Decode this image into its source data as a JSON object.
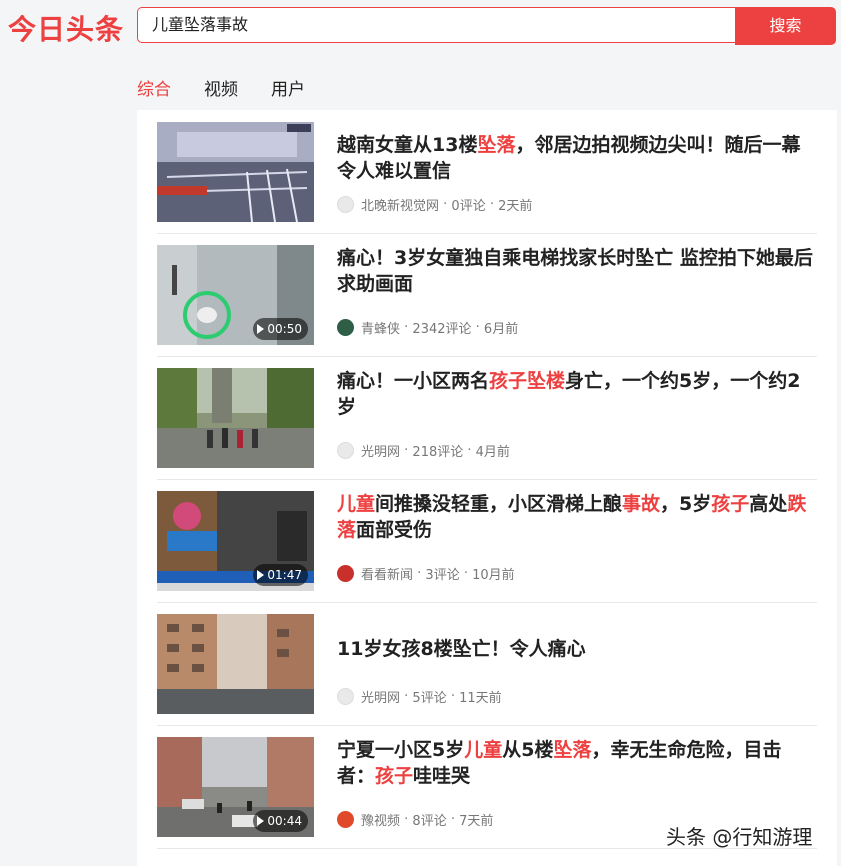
{
  "header": {
    "logo_text": "今日头条",
    "search_value": "儿童坠落事故",
    "search_button": "搜索"
  },
  "tabs": [
    {
      "label": "综合",
      "active": true
    },
    {
      "label": "视频",
      "active": false
    },
    {
      "label": "用户",
      "active": false
    }
  ],
  "results": [
    {
      "title": [
        {
          "t": "越南女童从13楼"
        },
        {
          "t": "坠落",
          "hl": true
        },
        {
          "t": "，邻居边拍视频边尖叫！随后一幕令人难以置信"
        }
      ],
      "source": "北晚新视觉网",
      "comments": "0评论",
      "time": "2天前",
      "source_icon": "newspaper-icon",
      "duration": null
    },
    {
      "title": [
        {
          "t": "痛心！3岁女童独自乘电梯找家长时坠亡 监控拍下她最后求助画面"
        }
      ],
      "source": "青蜂侠",
      "comments": "2342评论",
      "time": "6月前",
      "source_icon": "shield-icon",
      "duration": "00:50"
    },
    {
      "title": [
        {
          "t": "痛心！一小区两名"
        },
        {
          "t": "孩子坠楼",
          "hl": true
        },
        {
          "t": "身亡，一个约5岁，一个约2岁"
        }
      ],
      "source": "光明网",
      "comments": "218评论",
      "time": "4月前",
      "source_icon": "newspaper-icon",
      "duration": null
    },
    {
      "title": [
        {
          "t": "儿童",
          "hl": true
        },
        {
          "t": "间推搡没轻重，小区滑梯上酿"
        },
        {
          "t": "事故",
          "hl": true
        },
        {
          "t": "，5岁"
        },
        {
          "t": "孩子",
          "hl": true
        },
        {
          "t": "高处"
        },
        {
          "t": "跌落",
          "hl": true
        },
        {
          "t": "面部受伤"
        }
      ],
      "source": "看看新闻",
      "comments": "3评论",
      "time": "10月前",
      "source_icon": "k-logo-icon",
      "duration": "01:47"
    },
    {
      "title": [
        {
          "t": "11岁女孩8楼坠亡！令人痛心"
        }
      ],
      "source": "光明网",
      "comments": "5评论",
      "time": "11天前",
      "source_icon": "newspaper-icon",
      "duration": null
    },
    {
      "title": [
        {
          "t": "宁夏一小区5岁"
        },
        {
          "t": "儿童",
          "hl": true
        },
        {
          "t": "从5楼"
        },
        {
          "t": "坠落",
          "hl": true
        },
        {
          "t": "，幸无生命危险，目击者："
        },
        {
          "t": "孩子",
          "hl": true
        },
        {
          "t": "哇哇哭"
        }
      ],
      "source": "豫视频",
      "comments": "8评论",
      "time": "7天前",
      "source_icon": "play-logo-icon",
      "duration": "00:44"
    }
  ],
  "watermark": "头条 @行知游理",
  "colors": {
    "accent": "#ed4040",
    "text": "#222222",
    "meta": "#777777",
    "bg": "#f4f5f6"
  }
}
